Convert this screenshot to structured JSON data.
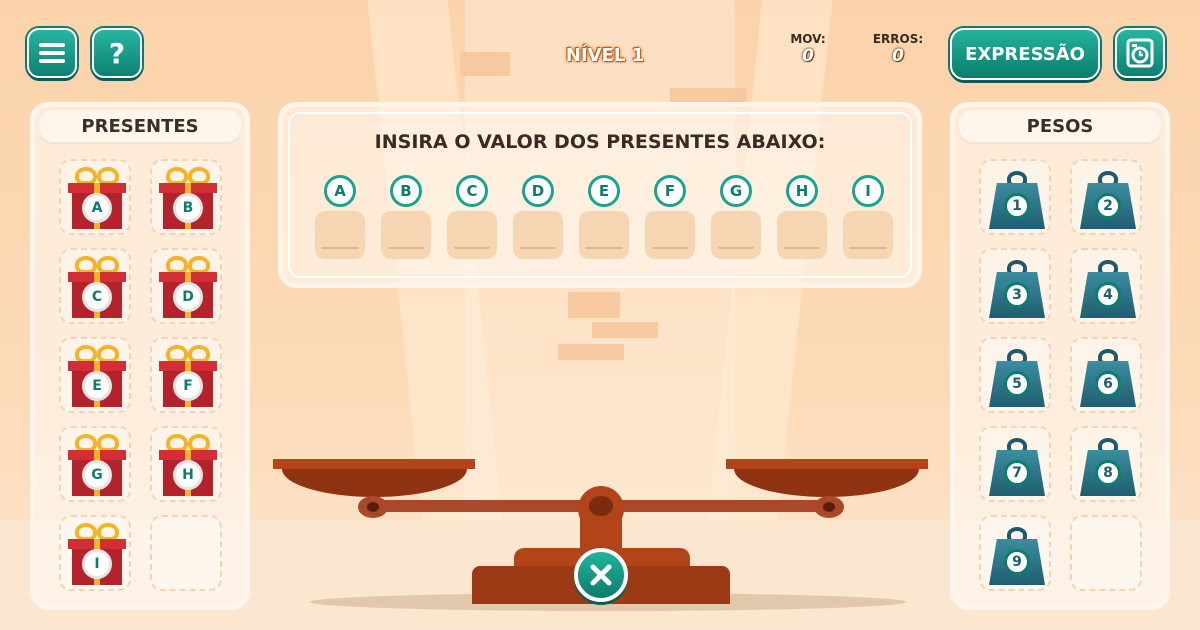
{
  "header": {
    "menu_icon": "menu-icon",
    "help_label": "?",
    "level_label": "NÍVEL 1",
    "moves_label": "MOV:",
    "moves_value": "0",
    "errors_label": "ERROS:",
    "errors_value": "0",
    "expression_label": "EXPRESSÃO",
    "timer_icon": "timer-icon"
  },
  "gifts_panel": {
    "title": "PRESENTES",
    "gifts": [
      "A",
      "B",
      "C",
      "D",
      "E",
      "F",
      "G",
      "H",
      "I"
    ]
  },
  "weights_panel": {
    "title": "PESOS",
    "weights": [
      "1",
      "2",
      "3",
      "4",
      "5",
      "6",
      "7",
      "8",
      "9"
    ]
  },
  "question": {
    "title": "INSIRA O VALOR DOS PRESENTES ABAIXO:",
    "letters": [
      "A",
      "B",
      "C",
      "D",
      "E",
      "F",
      "G",
      "H",
      "I"
    ]
  },
  "scale": {
    "reset_icon": "close-icon"
  },
  "colors": {
    "accent": "#0e8071",
    "gift_red": "#b4232c",
    "ribbon": "#f2b428",
    "weight_blue": "#2b7587",
    "scale_brown": "#a0401c"
  }
}
